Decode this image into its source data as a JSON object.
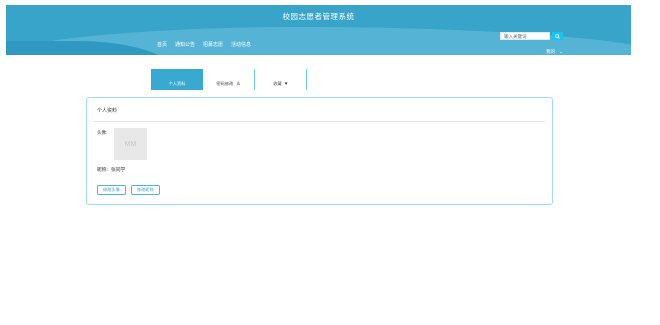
{
  "header": {
    "title": "校园志愿者管理系统",
    "nav": [
      "首页",
      "通知公告",
      "招募志愿",
      "活动信息"
    ],
    "search_placeholder": "输入关键词",
    "user_label": "我的"
  },
  "tabs": [
    {
      "label": "个人资料",
      "active": true
    },
    {
      "label": "密码修改",
      "icon": "user-icon"
    },
    {
      "label": "收藏",
      "icon": "heart-icon"
    }
  ],
  "profile": {
    "title": "个人资料",
    "avatar_label": "头像:",
    "avatar_placeholder": "MM",
    "nickname_label": "昵称:",
    "nickname_value": "张同学",
    "buttons": [
      "修改头像",
      "修改昵称"
    ]
  },
  "colors": {
    "header": "#39a4ca",
    "accent": "#3aa9d1",
    "card_border": "#9fdcf0"
  }
}
